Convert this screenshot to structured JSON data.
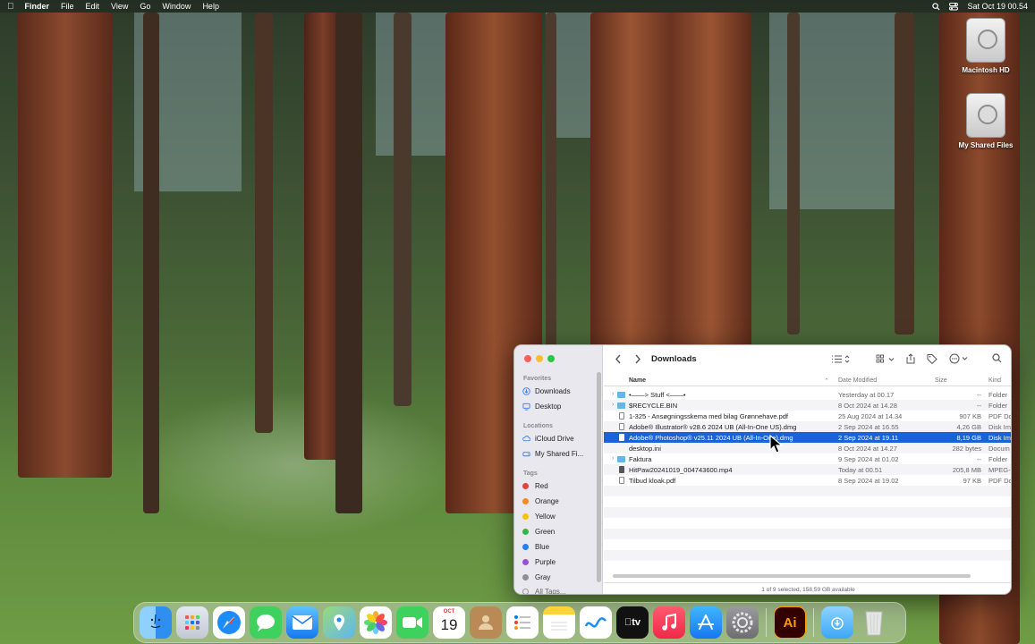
{
  "menubar": {
    "app_name": "Finder",
    "menus": [
      "File",
      "Edit",
      "View",
      "Go",
      "Window",
      "Help"
    ],
    "clock": "Sat Oct 19  00.54"
  },
  "desktop": {
    "icons": [
      {
        "label": "Macintosh HD"
      },
      {
        "label": "My Shared Files"
      }
    ]
  },
  "finder": {
    "title": "Downloads",
    "sidebar": {
      "favorites_heading": "Favorites",
      "favorites": [
        "Downloads",
        "Desktop"
      ],
      "locations_heading": "Locations",
      "locations": [
        "iCloud Drive",
        "My Shared Fi..."
      ],
      "tags_heading": "Tags",
      "tags": [
        {
          "label": "Red",
          "color": "#e0443e"
        },
        {
          "label": "Orange",
          "color": "#f08a24"
        },
        {
          "label": "Yellow",
          "color": "#f4c20d"
        },
        {
          "label": "Green",
          "color": "#35b44a"
        },
        {
          "label": "Blue",
          "color": "#2b7cf0"
        },
        {
          "label": "Purple",
          "color": "#9b4fd1"
        },
        {
          "label": "Gray",
          "color": "#8e8e93"
        }
      ],
      "all_tags": "All Tags..."
    },
    "columns": {
      "name": "Name",
      "date": "Date Modified",
      "size": "Size",
      "kind": "Kind"
    },
    "rows": [
      {
        "name": "•——>  Stuff  <——•",
        "date": "Yesterday at 00.17",
        "size": "--",
        "kind": "Folder",
        "type": "folder"
      },
      {
        "name": "$RECYCLE.BIN",
        "date": "8 Oct 2024 at 14.28",
        "size": "--",
        "kind": "Folder",
        "type": "folder"
      },
      {
        "name": "1-325 - Ansøgningsskema med bilag Grønnehave.pdf",
        "date": "25 Aug 2024 at 14.34",
        "size": "907 KB",
        "kind": "PDF Do",
        "type": "doc"
      },
      {
        "name": "Adobe® Illustrator® v28.6 2024 UB (All-In-One US).dmg",
        "date": "2 Sep 2024 at 16.55",
        "size": "4,26 GB",
        "kind": "Disk Im",
        "type": "doc"
      },
      {
        "name": "Adobe® Photoshop® v25.11 2024 UB (All-In-One).dmg",
        "date": "2 Sep 2024 at 19.11",
        "size": "8,19 GB",
        "kind": "Disk Im",
        "type": "doc",
        "selected": true
      },
      {
        "name": "desktop.ini",
        "date": "8 Oct 2024 at 14.27",
        "size": "282 bytes",
        "kind": "Docum",
        "type": "blank"
      },
      {
        "name": "Faktura",
        "date": "9 Sep 2024 at 01.02",
        "size": "--",
        "kind": "Folder",
        "type": "folder"
      },
      {
        "name": "HitPaw20241019_004743600.mp4",
        "date": "Today at 00.51",
        "size": "205,8 MB",
        "kind": "MPEG-",
        "type": "doc"
      },
      {
        "name": "Tilbud kloak.pdf",
        "date": "8 Sep 2024 at 19.02",
        "size": "97 KB",
        "kind": "PDF Do",
        "type": "doc"
      }
    ],
    "status": "1 of 9 selected, 158,59 GB available"
  },
  "dock": {
    "calendar_month": "OCT",
    "calendar_day": "19",
    "illustrator_label": "Ai",
    "tv_label": "tv"
  }
}
